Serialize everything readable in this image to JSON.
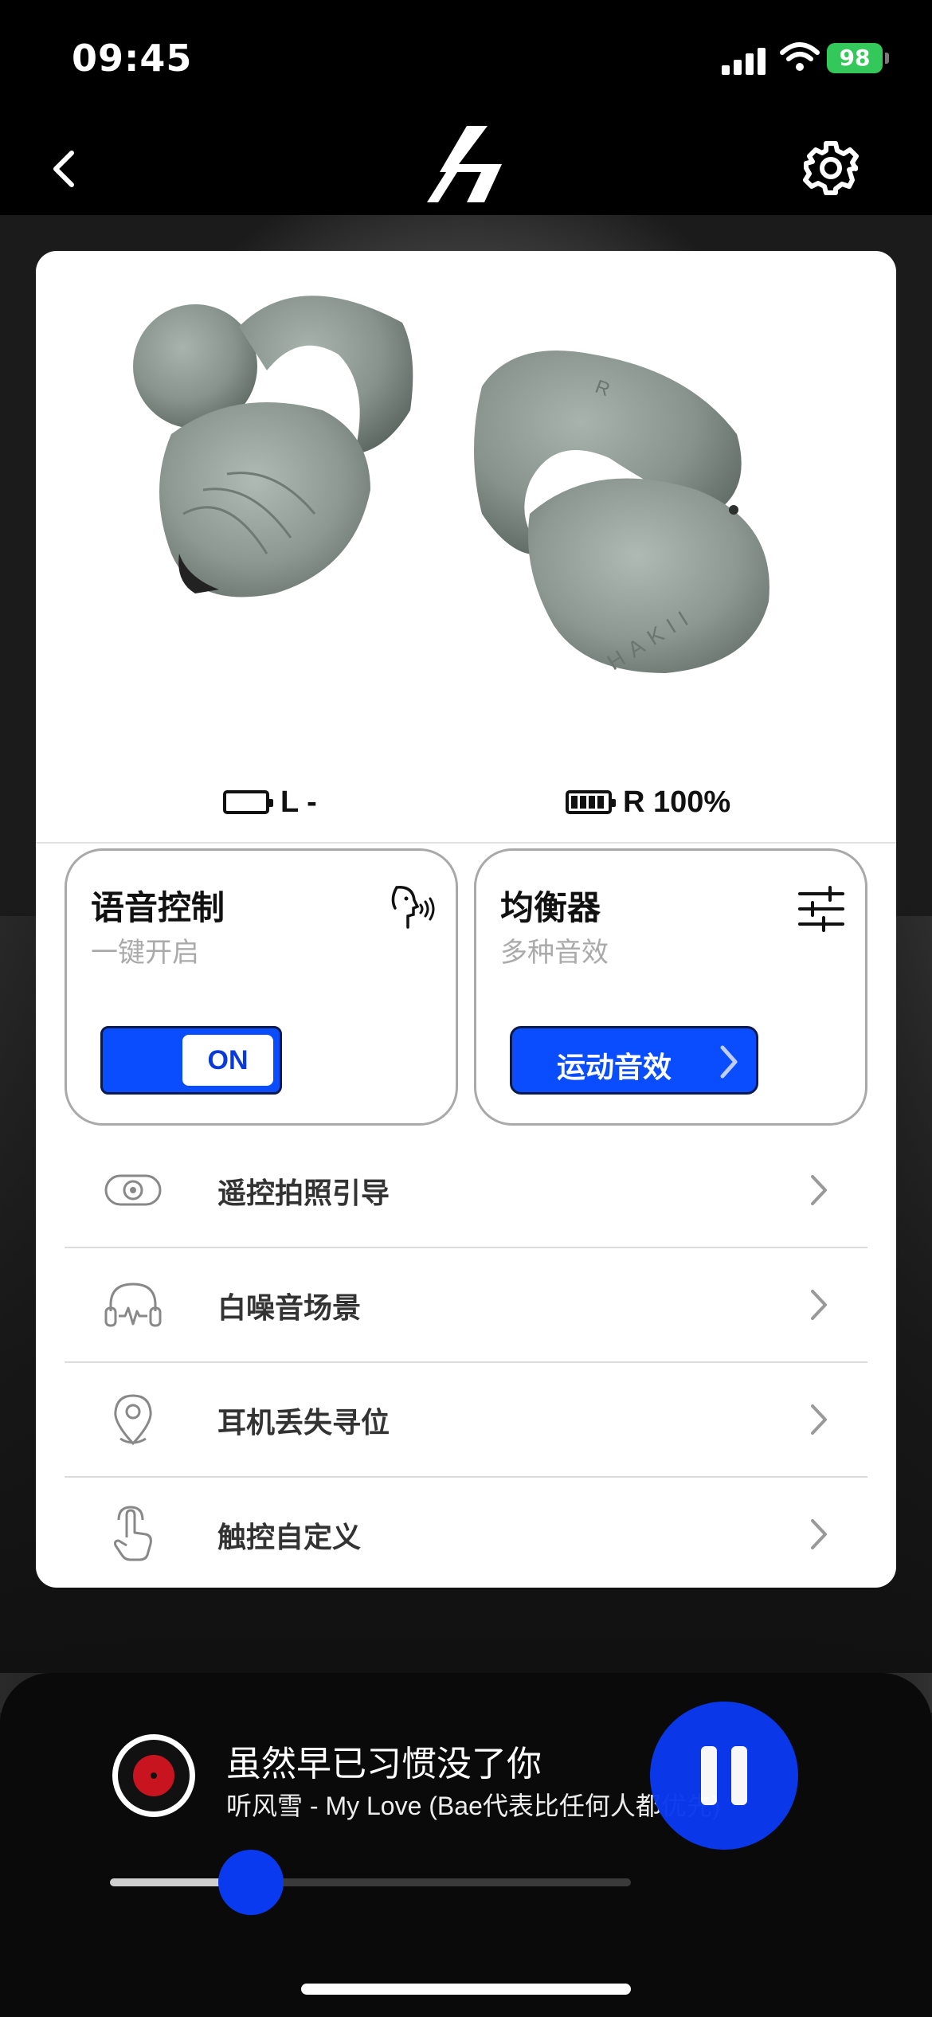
{
  "status_bar": {
    "time": "09:45",
    "battery": "98"
  },
  "header": {
    "back_icon": "chevron-left-icon",
    "logo_icon": "hakii-logo",
    "settings_icon": "gear-icon"
  },
  "device": {
    "image_label": "HAKII",
    "left_battery": "L -",
    "right_battery": "R 100%"
  },
  "voice_control": {
    "title": "语音控制",
    "subtitle": "一键开启",
    "toggle_label": "ON",
    "icon": "voice-speaking-icon"
  },
  "equalizer": {
    "title": "均衡器",
    "subtitle": "多种音效",
    "button_label": "运动音效",
    "icon": "sliders-icon"
  },
  "menu": [
    {
      "label": "遥控拍照引导",
      "icon": "camera-remote-icon"
    },
    {
      "label": "白噪音场景",
      "icon": "headphones-icon"
    },
    {
      "label": "耳机丢失寻位",
      "icon": "location-pin-icon"
    },
    {
      "label": "触控自定义",
      "icon": "touch-hand-icon"
    }
  ],
  "player": {
    "title": "虽然早已习惯没了你",
    "subtitle": "听风雪 - My Love (Bae代表比任何人都优先)",
    "progress": 0.27,
    "accent": "#0a3af0"
  }
}
